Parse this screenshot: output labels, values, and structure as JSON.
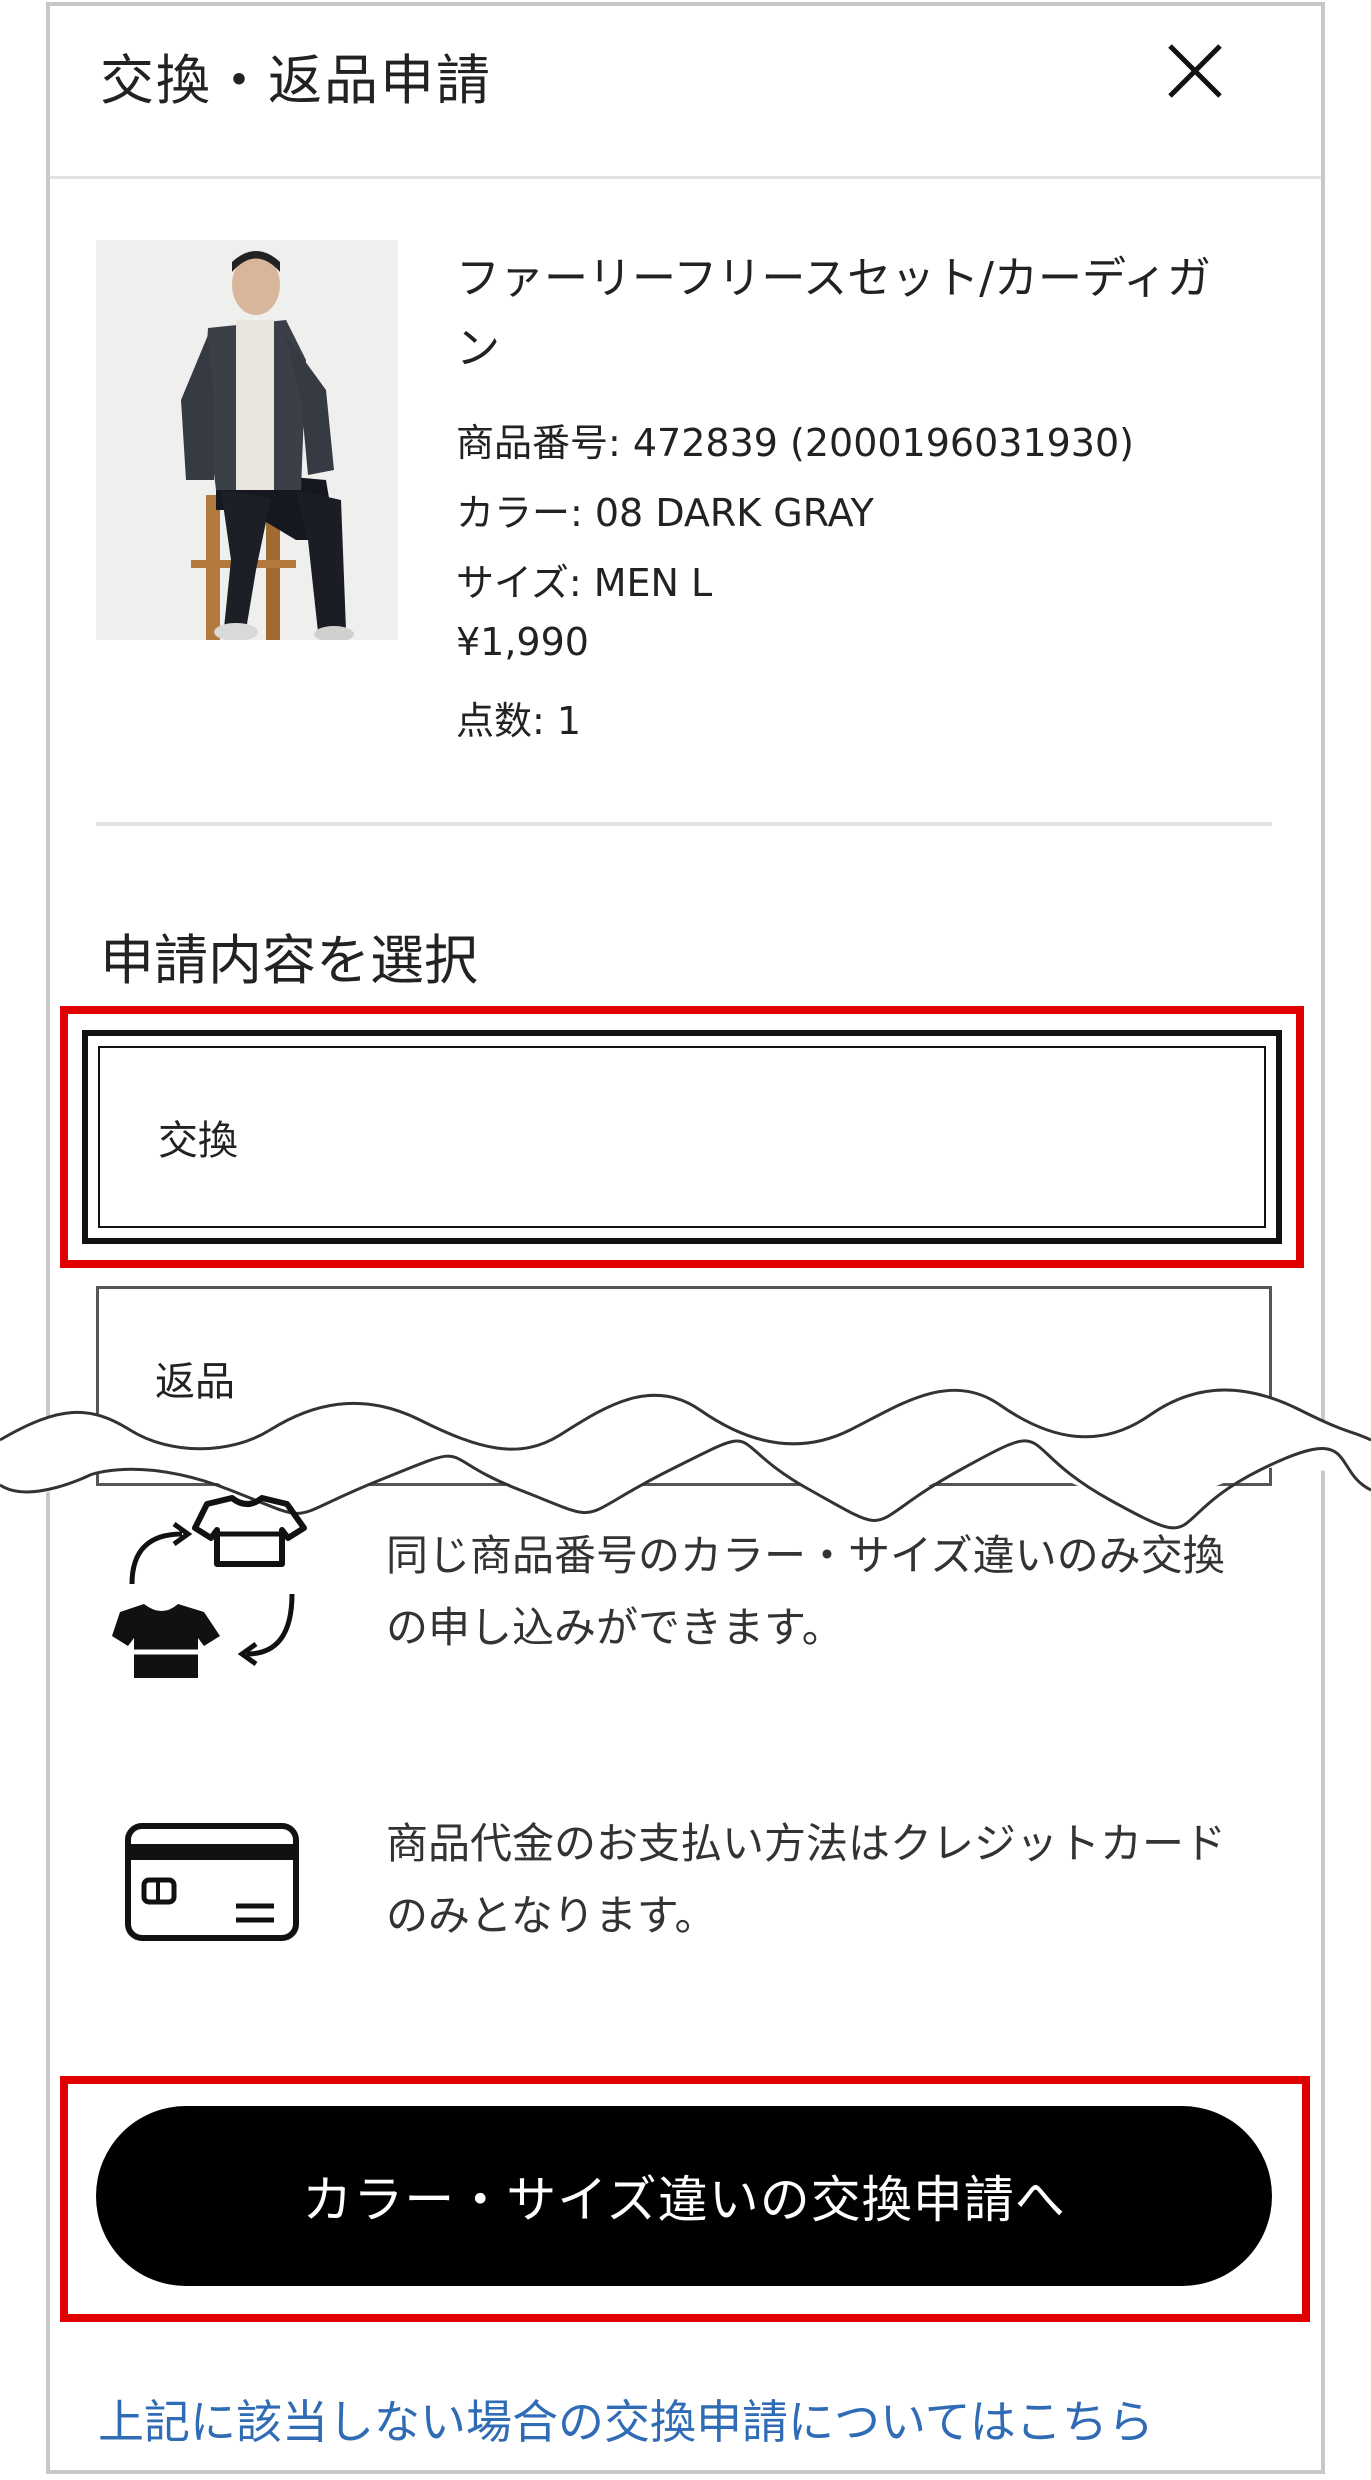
{
  "header": {
    "title": "交換・返品申請",
    "close_icon": "close-icon"
  },
  "product": {
    "image_icon": "product-photo",
    "name": "ファーリーフリースセット/カーディガン",
    "item_number": "商品番号: 472839 (2000196031930)",
    "color": "カラー: 08 DARK GRAY",
    "size": "サイズ: MEN L",
    "price": "¥1,990",
    "quantity": "点数: 1"
  },
  "selection": {
    "title": "申請内容を選択",
    "options": [
      {
        "label": "交換",
        "selected": true
      },
      {
        "label": "返品",
        "selected": false
      }
    ]
  },
  "info": [
    {
      "icon": "shirt-exchange-icon",
      "text": "同じ商品番号のカラー・サイズ違いのみ交換の申し込みができます。"
    },
    {
      "icon": "credit-card-icon",
      "text": "商品代金のお支払い方法はクレジットカードのみとなります。"
    }
  ],
  "cta": {
    "label": "カラー・サイズ違いの交換申請へ"
  },
  "footer_link": {
    "label": "上記に該当しない場合の交換申請についてはこちら"
  },
  "colors": {
    "highlight": "#e00000",
    "link": "#2f6cb5",
    "button": "#000000"
  }
}
